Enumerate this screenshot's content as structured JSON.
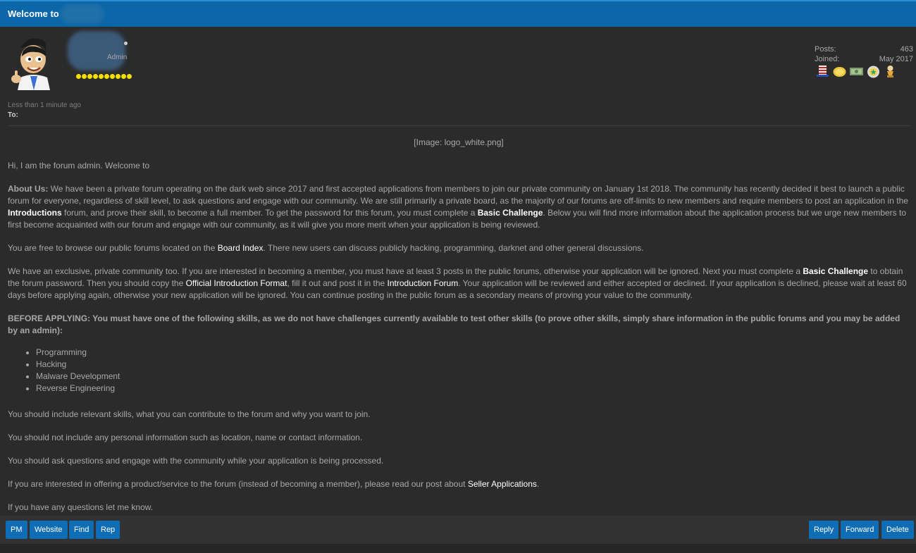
{
  "header": {
    "title": "Welcome to"
  },
  "profile": {
    "rank": "Admin",
    "stats": [
      {
        "label": "Posts:",
        "value": "463"
      },
      {
        "label": "Joined:",
        "value": "May 2017"
      }
    ],
    "rank_stars": 10,
    "badges": [
      "hat-badge",
      "coin-badge",
      "cash-badge",
      "medal-badge",
      "trophy-badge"
    ]
  },
  "post": {
    "time": "Less than 1 minute ago",
    "to_label": "To:",
    "image_placeholder": "[Image: logo_white.png]",
    "greeting": "Hi, I am the forum admin. Welcome to",
    "about": {
      "label": "About Us:",
      "t1": " We have been a private forum operating on the dark web since 2017 and first accepted applications from members to join our private community on January 1st 2018. The community has recently decided it best to launch a public forum for everyone, regardless of skill level, to ask questions and engage with our community. We are still primarily a private board, as the majority of our forums are off-limits to new members and require members to post an application in the ",
      "link1": "Introductions",
      "t2": " forum, and prove their skill, to become a full member. To get the password for this forum, you must complete a ",
      "link2": "Basic Challenge",
      "t3": ". Below you will find more information about the application process but we urge new members to first become acquainted with our forum and engage with our community, as it will give you more merit when your application is being reviewed."
    },
    "browse": {
      "t1": "You are free to browse our public forums located on the ",
      "link": "Board Index",
      "t2": ". There new users can discuss publicly hacking, programming, darknet and other general discussions."
    },
    "exclusive": {
      "t1": "We have an exclusive, private community too. If you are interested in becoming a member, you must have at least 3 posts in the public forums, otherwise your application will be ignored. Next you must complete a ",
      "link1": "Basic Challenge",
      "t2": " to obtain the forum password. Then you should copy the ",
      "link2": "Official Introduction Format",
      "t3": ", fill it out and post it in the ",
      "link3": "Introduction Forum",
      "t4": ". Your application will be reviewed and either accepted or declined. If your application is declined, please wait at least 60 days before applying again, otherwise your new application will be ignored. You can continue posting in the public forum as a secondary means of proving your value to the community."
    },
    "before_applying": "BEFORE APPLYING: You must have one of the following skills, as we do not have challenges currently available to test other skills (to prove other skills, simply share information in the public forums and you may be added by an admin):",
    "skills": [
      "Programming",
      "Hacking",
      "Malware Development",
      "Reverse Engineering"
    ],
    "include": "You should include relevant skills, what you can contribute to the forum and why you want to join.",
    "not_include": "You should not include any personal information such as location, name or contact information.",
    "ask": "You should ask questions and engage with the community while your application is being processed.",
    "seller": {
      "t1": "If you are interested in offering a product/service to the forum (instead of becoming a member), please read our post about ",
      "link": "Seller Applications",
      "t2": "."
    },
    "closing": "If you have any questions let me know."
  },
  "actions": {
    "left": [
      "PM",
      "Website",
      "Find",
      "Rep"
    ],
    "right": [
      "Reply",
      "Forward",
      "Delete"
    ]
  },
  "colors": {
    "header_bg": "#0b67a8",
    "page_bg": "#2b2b2b",
    "button_bg": "#0f6db6",
    "star": "#f2e000"
  }
}
